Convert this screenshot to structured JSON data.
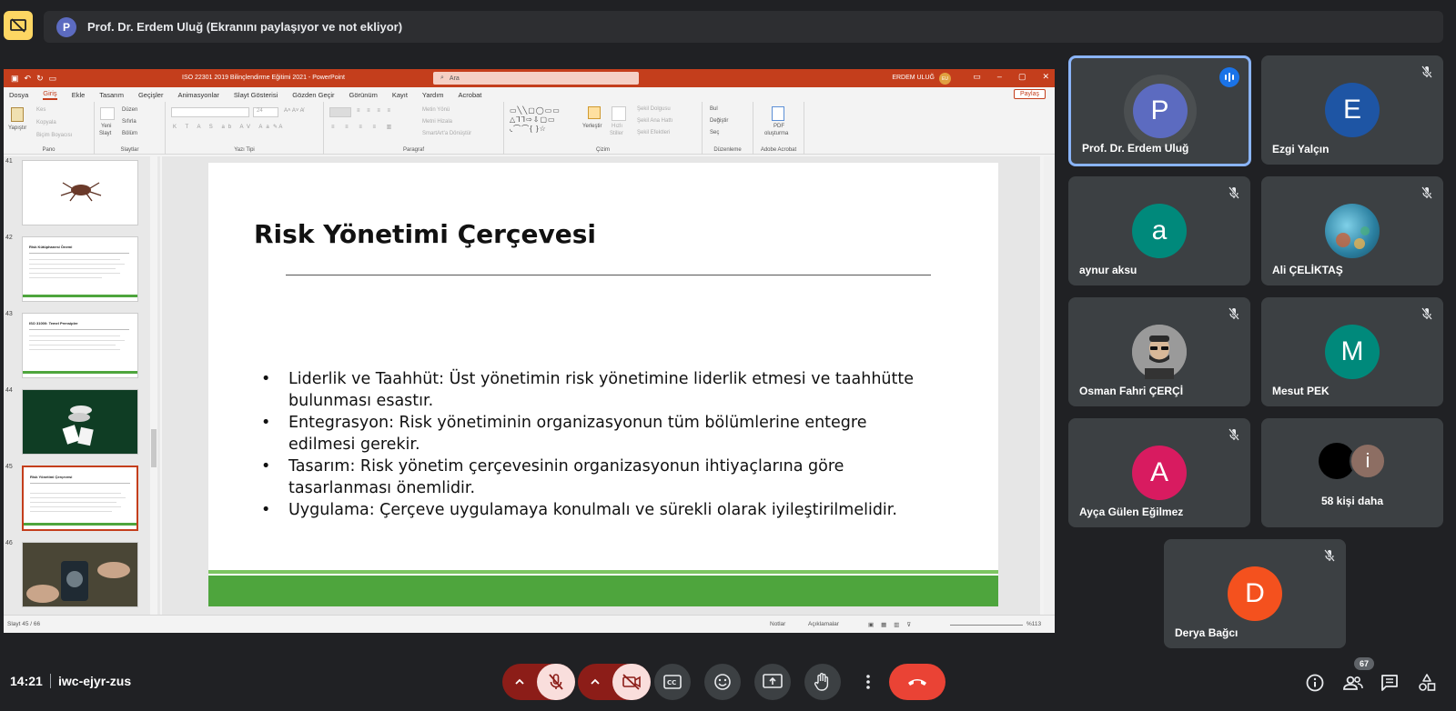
{
  "presenter_bar": {
    "avatar_letter": "P",
    "text": "Prof. Dr. Erdem Uluğ (Ekranını paylaşıyor ve not ekliyor)"
  },
  "ppt": {
    "doc_title": "ISO 22301 2019 Bilinçlendirme Eğitimi 2021 - PowerPoint",
    "search_placeholder": "Ara",
    "user_name": "ERDEM ULUĞ",
    "user_initials": "EU",
    "menu": [
      "Dosya",
      "Giriş",
      "Ekle",
      "Tasarım",
      "Geçişler",
      "Animasyonlar",
      "Slayt Gösterisi",
      "Gözden Geçir",
      "Görünüm",
      "Kayıt",
      "Yardım",
      "Acrobat"
    ],
    "share_label": "Paylaş",
    "ribbon": {
      "pano": {
        "label": "Pano",
        "paste": "Yapıştır",
        "cut": "Kes",
        "copy": "Kopyala",
        "format": "Biçim Boyacısı"
      },
      "slaytlar": {
        "label": "Slaytlar",
        "new_line1": "Yeni",
        "new_line2": "Slayt",
        "layout": "Düzen",
        "reset": "Sıfırla",
        "section": "Bölüm"
      },
      "yazi": {
        "label": "Yazı Tipi",
        "size": "24"
      },
      "paragraf": {
        "label": "Paragraf",
        "dir": "Metin Yönü",
        "align": "Metni Hizala",
        "smartart": "SmartArt'a Dönüştür"
      },
      "cizim": {
        "label": "Çizim",
        "arrange": "Yerleştir",
        "quick_line1": "Hızlı",
        "quick_line2": "Stiller",
        "fill": "Şekil Dolgusu",
        "outline": "Şekil Ana Hattı",
        "effects": "Şekil Efektleri"
      },
      "duzenleme": {
        "label": "Düzenleme",
        "find": "Bul",
        "replace": "Değiştir",
        "select": "Seç"
      },
      "acrobat": {
        "label": "Adobe Acrobat",
        "pdf_line1": "PDF",
        "pdf_line2": "oluşturma"
      }
    },
    "thumbnails": [
      {
        "num": "41",
        "title": ""
      },
      {
        "num": "42",
        "title": "Risk Kütüphanesi Önemi"
      },
      {
        "num": "43",
        "title": "ISO 31000: Temel Prensipler"
      },
      {
        "num": "44",
        "title": ""
      },
      {
        "num": "45",
        "title": "Risk Yönetimi Çerçevesi"
      },
      {
        "num": "46",
        "title": ""
      }
    ],
    "slide": {
      "title": "Risk Yönetimi Çerçevesi",
      "bullets": [
        "Liderlik ve Taahhüt: Üst yönetimin risk yönetimine liderlik etmesi ve taahhütte bulunması esastır.",
        "Entegrasyon: Risk yönetiminin organizasyonun tüm bölümlerine entegre edilmesi gerekir.",
        "Tasarım: Risk yönetim çerçevesinin organizasyonun ihtiyaçlarına göre tasarlanması önemlidir.",
        "Uygulama: Çerçeve uygulamaya konulmalı ve sürekli olarak iyileştirilmelidir."
      ]
    },
    "status": {
      "slide_counter": "Slayt 45 / 66",
      "notes": "Notlar",
      "comments": "Açıklamalar",
      "zoom": "%113"
    }
  },
  "participants": [
    {
      "name": "Prof. Dr. Erdem Uluğ",
      "letter": "P",
      "color": "#5c6bc0",
      "state": "speaking"
    },
    {
      "name": "Ezgi Yalçın",
      "letter": "E",
      "color": "#1e55a4",
      "state": "muted"
    },
    {
      "name": "aynur aksu",
      "letter": "a",
      "color": "#00897b",
      "state": "muted"
    },
    {
      "name": "Ali ÇELİKTAŞ",
      "letter": "",
      "color": "#3a8fb0",
      "state": "muted"
    },
    {
      "name": "Osman Fahri ÇERÇİ",
      "letter": "",
      "color": "#8a8a8a",
      "state": "muted"
    },
    {
      "name": "Mesut PEK",
      "letter": "M",
      "color": "#00897b",
      "state": "muted"
    },
    {
      "name": "Ayça Gülen Eğilmez",
      "letter": "A",
      "color": "#d81b60",
      "state": "muted"
    },
    {
      "name": "58 kişi daha",
      "letter": "i",
      "color": "#8d6e63",
      "state": "group"
    },
    {
      "name": "Derya Bağcı",
      "letter": "D",
      "color": "#f4511e",
      "state": "muted"
    }
  ],
  "bottom_bar": {
    "time": "14:21",
    "meeting_code": "iwc-ejyr-zus",
    "people_count": "67"
  },
  "colors": {
    "background": "#202124",
    "tile": "#3c4043",
    "hangup": "#ea4335",
    "accent_blue": "#8ab4f8",
    "ppt_red": "#c43e1c",
    "slide_green": "#4ea53d"
  }
}
